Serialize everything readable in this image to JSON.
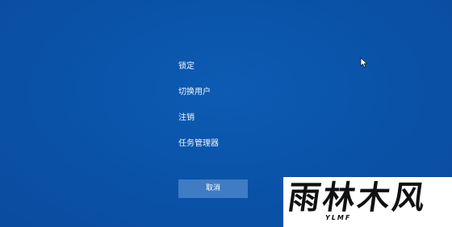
{
  "menu": {
    "items": [
      {
        "label": "锁定"
      },
      {
        "label": "切换用户"
      },
      {
        "label": "注销"
      },
      {
        "label": "任务管理器"
      }
    ]
  },
  "cancel_button": {
    "label": "取消"
  },
  "watermark": {
    "main": "雨林木风",
    "sub": "YLMF"
  },
  "colors": {
    "background": "#0a52a8",
    "button": "#3f7cc4",
    "text": "#ffffff"
  },
  "icons": {
    "cursor": "mouse-pointer-icon"
  }
}
